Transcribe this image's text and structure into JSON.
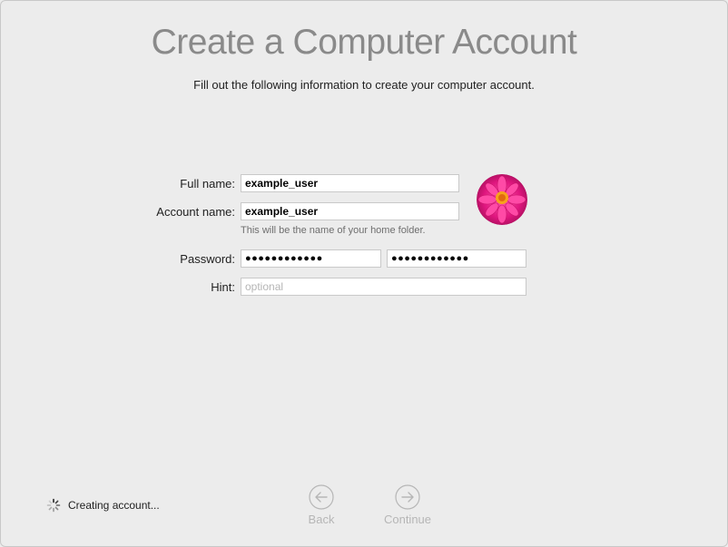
{
  "header": {
    "title": "Create a Computer Account",
    "subtitle": "Fill out the following information to create your computer account."
  },
  "form": {
    "full_name_label": "Full name:",
    "full_name_value": "example_user",
    "account_name_label": "Account name:",
    "account_name_value": "example_user",
    "account_name_note": "This will be the name of your home folder.",
    "password_label": "Password:",
    "password_value": "●●●●●●●●●●●●",
    "password_verify_value": "●●●●●●●●●●●●",
    "hint_label": "Hint:",
    "hint_placeholder": "optional"
  },
  "status": {
    "text": "Creating account..."
  },
  "nav": {
    "back_label": "Back",
    "continue_label": "Continue"
  },
  "colors": {
    "background": "#ececec",
    "title": "#8a8a8a",
    "disabled": "#b6b6b6"
  }
}
